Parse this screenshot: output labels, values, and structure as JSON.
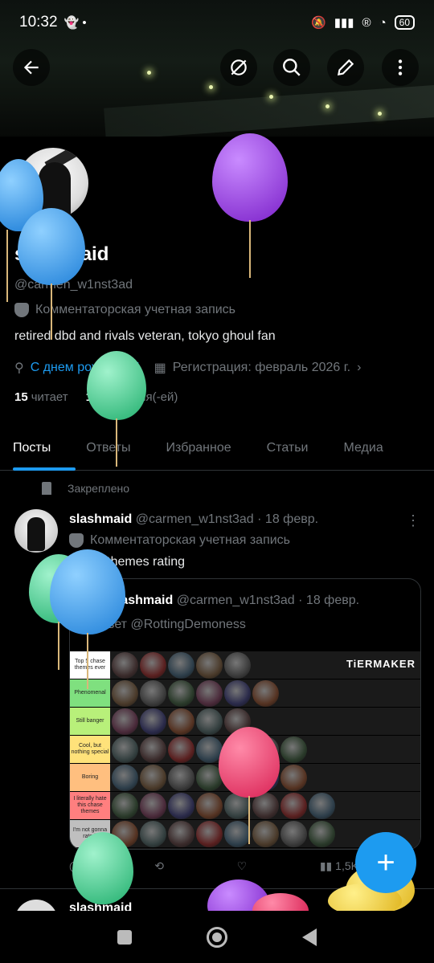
{
  "status_bar": {
    "time": "10:32",
    "battery": "60"
  },
  "profile": {
    "name": "slashmaid",
    "handle": "@carmen_w1nst3ad",
    "account_type": "Комментаторская учетная запись",
    "bio": "retired dbd and rivals veteran, tokyo ghoul fan",
    "birthday_link": "С днем рождения!",
    "joined": "Регистрация: февраль 2026 г.",
    "following_count": "15",
    "following_label": "читает",
    "followers_count": "16",
    "followers_label": "читателя(-ей)"
  },
  "tabs": [
    "Посты",
    "Ответы",
    "Избранное",
    "Статьи",
    "Медиа"
  ],
  "post": {
    "pinned_label": "Закреплено",
    "name": "slashmaid",
    "handle_date": "@carmen_w1nst3ad · 18 февр.",
    "account_type": "Комментаторская учетная запись",
    "text": "chase themes rating",
    "quote": {
      "name": "slashmaid",
      "handle_date": "@carmen_w1nst3ad · 18 февр.",
      "reply_to": "В ответ @RottingDemoness"
    },
    "tiers": [
      {
        "label": "Top 5 chase themes ever",
        "color": "#ffffff"
      },
      {
        "label": "Phenomenal",
        "color": "#7fe07f"
      },
      {
        "label": "Still banger",
        "color": "#b8f07a"
      },
      {
        "label": "Cool, but nothing special",
        "color": "#ffe27a"
      },
      {
        "label": "Boring",
        "color": "#ffbf7f"
      },
      {
        "label": "I literally hate this chase themes",
        "color": "#ff7f7f"
      },
      {
        "label": "I'm not gonna rate it",
        "color": "#bfbfbf"
      }
    ],
    "tier_logo": "TiERMAKER",
    "views": "1,5K"
  },
  "next_post": {
    "name": "slashmaid"
  }
}
